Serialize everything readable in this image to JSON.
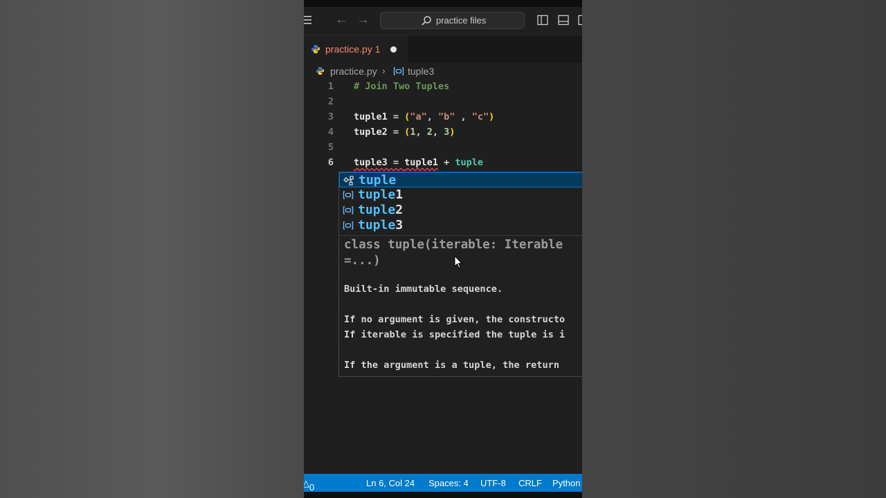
{
  "titlebar": {
    "search_text": "practice files"
  },
  "tab": {
    "filename": "practice.py",
    "problem_count": "1"
  },
  "breadcrumb": {
    "file": "practice.py",
    "symbol": "tuple3"
  },
  "code": {
    "line_numbers": [
      "1",
      "2",
      "3",
      "4",
      "5",
      "6"
    ],
    "comment": "# Join Two Tuples",
    "tuple1_name": "tuple1",
    "tuple1_values": [
      "\"a\"",
      "\"b\"",
      "\"c\""
    ],
    "tuple2_name": "tuple2",
    "tuple2_values": [
      "1",
      "2",
      "3"
    ],
    "line6_target": "tuple3",
    "line6_operand": "tuple1",
    "line6_partial": "tuple"
  },
  "suggest": {
    "match_prefix": "tuple",
    "items": [
      {
        "label": "tuple",
        "kind": "class",
        "rest": ""
      },
      {
        "label": "tuple",
        "kind": "variable",
        "rest": "1"
      },
      {
        "label": "tuple",
        "kind": "variable",
        "rest": "2"
      },
      {
        "label": "tuple",
        "kind": "variable",
        "rest": "3"
      }
    ],
    "doc_signature_1": "class tuple(iterable: Iterable",
    "doc_signature_2": "=...)",
    "doc_lines": [
      "Built-in immutable sequence.",
      "",
      "If no argument is given, the constructo",
      "If iterable is specified the tuple is i",
      "",
      "If the argument is a tuple, the return"
    ]
  },
  "statusbar": {
    "warnings": "0",
    "position": "Ln 6, Col 24",
    "spaces": "Spaces: 4",
    "encoding": "UTF-8",
    "eol": "CRLF",
    "language": "Python"
  },
  "colors": {
    "statusbar": "#007acc",
    "editor_bg": "#1f1f1f",
    "error_tab": "#f48771",
    "suggest_highlight": "#4fc1ff"
  }
}
